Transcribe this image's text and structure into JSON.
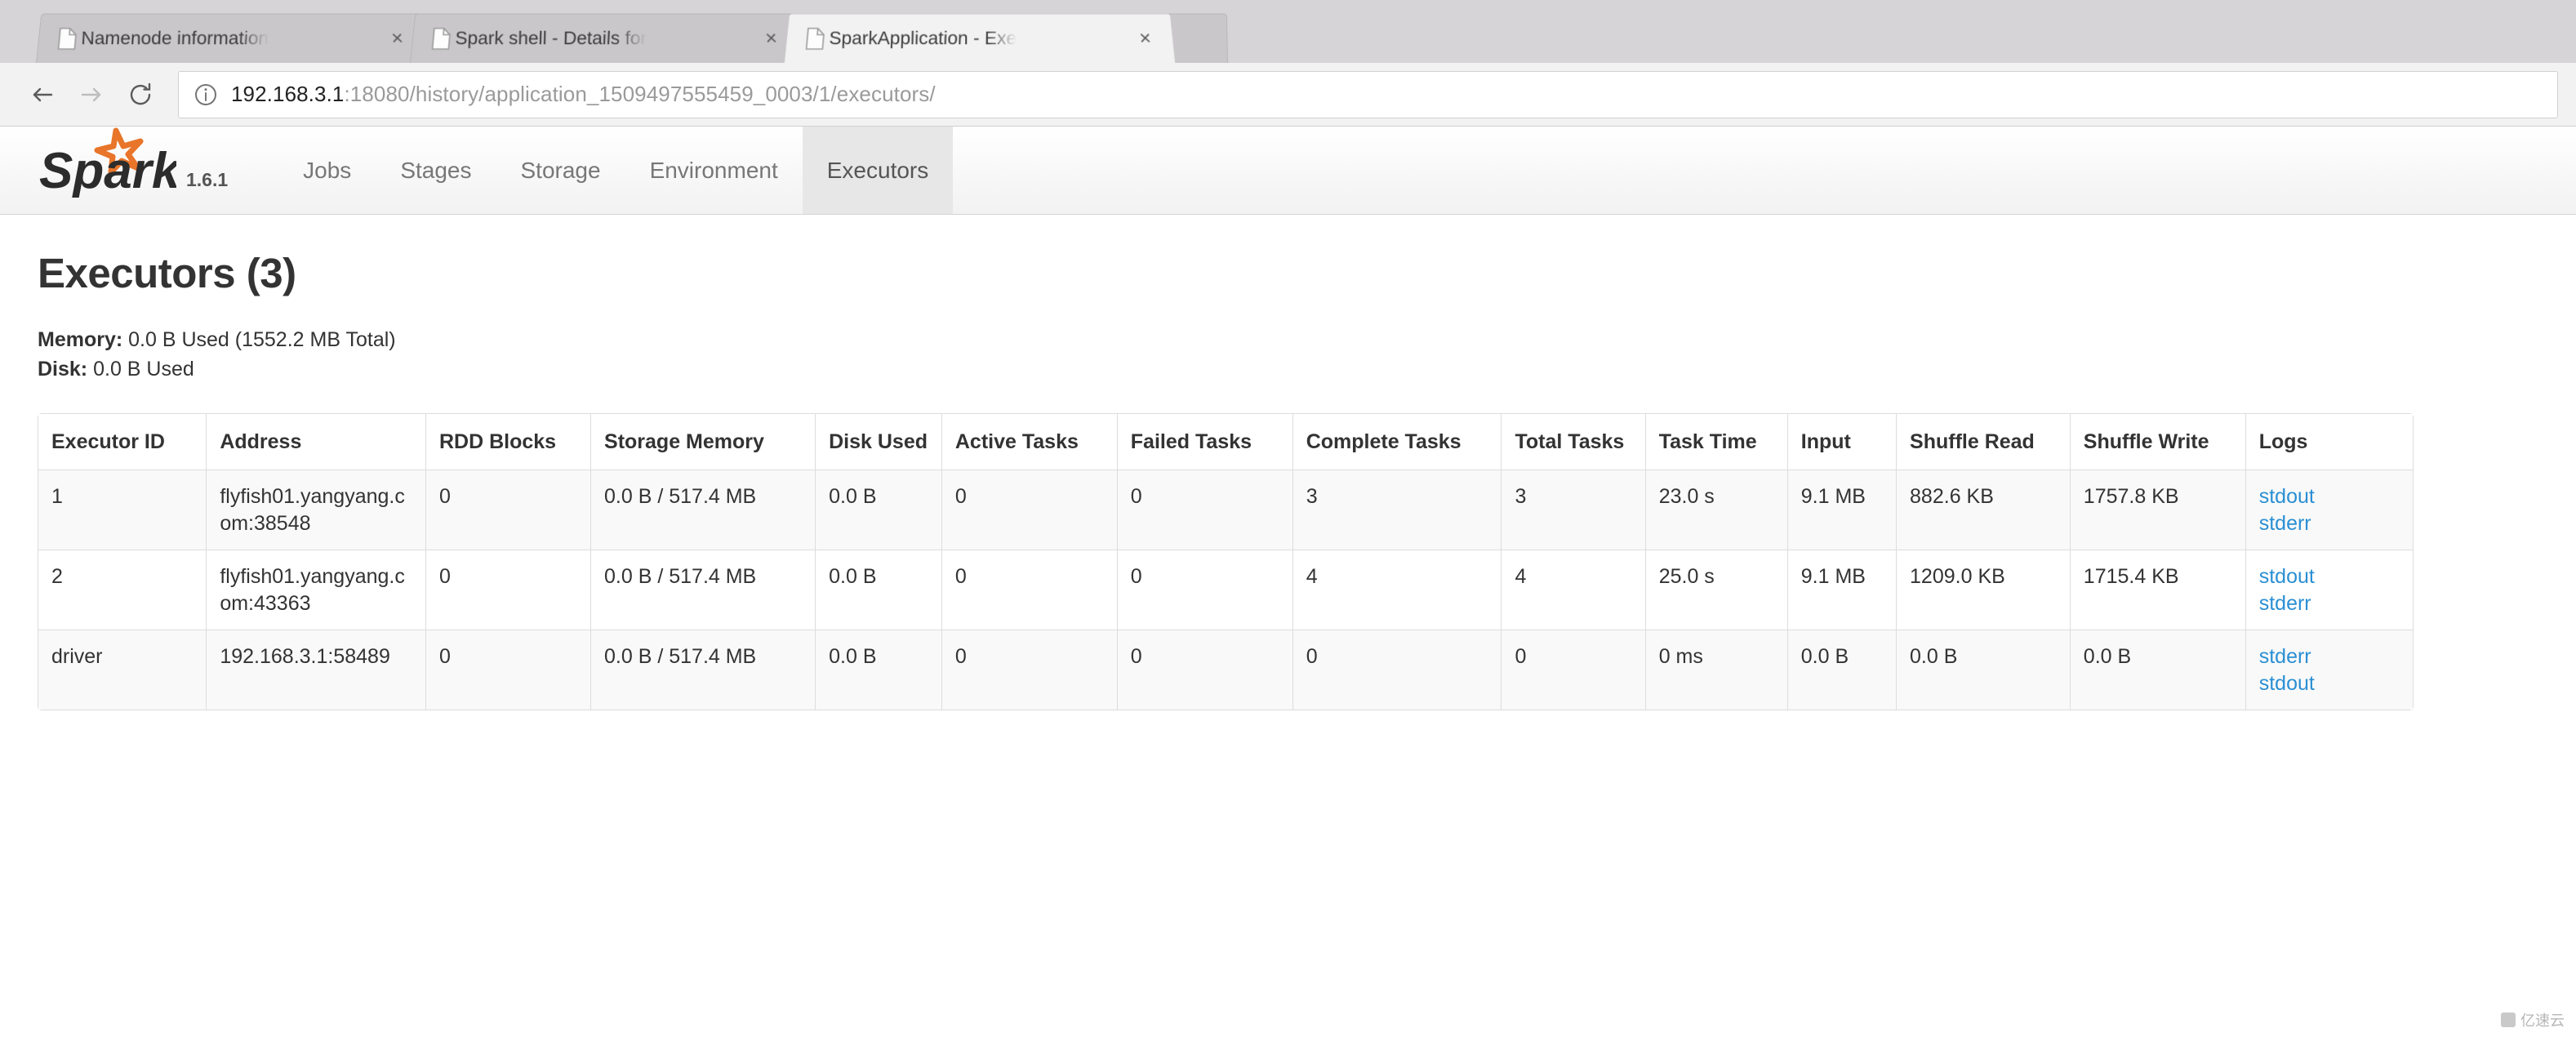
{
  "browser": {
    "tabs": [
      {
        "title": "Namenode information",
        "favicon": "page-icon",
        "close": "×",
        "active": false
      },
      {
        "title": "Spark shell - Details for",
        "favicon": "page-icon",
        "close": "×",
        "active": false
      },
      {
        "title": "SparkApplication - Exe",
        "favicon": "page-icon",
        "close": "×",
        "active": true
      }
    ],
    "toolbar": {
      "back": "←",
      "forward": "→",
      "reload": "⟳",
      "info_icon": "info-circle-icon"
    },
    "omnibox": {
      "host": "192.168.3.1",
      "path": ":18080/history/application_1509497555459_0003/1/executors/"
    }
  },
  "spark": {
    "brand": {
      "name": "Spark",
      "version": "1.6.1"
    },
    "nav": [
      {
        "label": "Jobs",
        "active": false
      },
      {
        "label": "Stages",
        "active": false
      },
      {
        "label": "Storage",
        "active": false
      },
      {
        "label": "Environment",
        "active": false
      },
      {
        "label": "Executors",
        "active": true
      }
    ],
    "page_title": "Executors (3)",
    "summary": {
      "memory_label": "Memory:",
      "memory_value": "0.0 B Used (1552.2 MB Total)",
      "disk_label": "Disk:",
      "disk_value": "0.0 B Used"
    },
    "table": {
      "headers": [
        "Executor ID",
        "Address",
        "RDD Blocks",
        "Storage Memory",
        "Disk Used",
        "Active Tasks",
        "Failed Tasks",
        "Complete Tasks",
        "Total Tasks",
        "Task Time",
        "Input",
        "Shuffle Read",
        "Shuffle Write",
        "Logs"
      ],
      "rows": [
        {
          "executor_id": "1",
          "address": "flyfish01.yangyang.com:38548",
          "rdd_blocks": "0",
          "storage_memory": "0.0 B / 517.4 MB",
          "disk_used": "0.0 B",
          "active_tasks": "0",
          "failed_tasks": "0",
          "complete_tasks": "3",
          "total_tasks": "3",
          "task_time": "23.0 s",
          "input": "9.1 MB",
          "shuffle_read": "882.6 KB",
          "shuffle_write": "1757.8 KB",
          "logs": [
            "stdout",
            "stderr"
          ]
        },
        {
          "executor_id": "2",
          "address": "flyfish01.yangyang.com:43363",
          "rdd_blocks": "0",
          "storage_memory": "0.0 B / 517.4 MB",
          "disk_used": "0.0 B",
          "active_tasks": "0",
          "failed_tasks": "0",
          "complete_tasks": "4",
          "total_tasks": "4",
          "task_time": "25.0 s",
          "input": "9.1 MB",
          "shuffle_read": "1209.0 KB",
          "shuffle_write": "1715.4 KB",
          "logs": [
            "stdout",
            "stderr"
          ]
        },
        {
          "executor_id": "driver",
          "address": "192.168.3.1:58489",
          "rdd_blocks": "0",
          "storage_memory": "0.0 B / 517.4 MB",
          "disk_used": "0.0 B",
          "active_tasks": "0",
          "failed_tasks": "0",
          "complete_tasks": "0",
          "total_tasks": "0",
          "task_time": "0 ms",
          "input": "0.0 B",
          "shuffle_read": "0.0 B",
          "shuffle_write": "0.0 B",
          "logs": [
            "stderr",
            "stdout"
          ]
        }
      ]
    }
  },
  "watermark": {
    "text": "亿速云"
  },
  "colors": {
    "link": "#2a8fd4",
    "accent": "#e8752a",
    "active_tab_bg": "#e7e7e7"
  }
}
